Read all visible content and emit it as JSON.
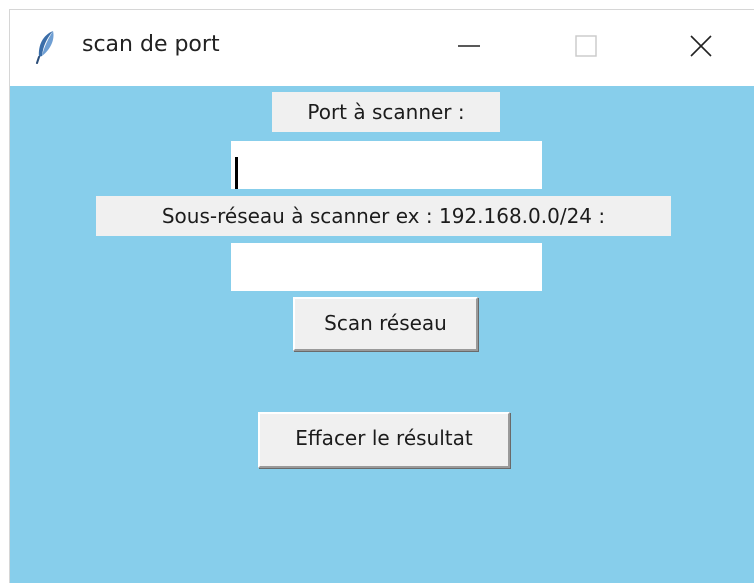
{
  "window": {
    "title": "scan de port",
    "icons": {
      "app": "feather-icon",
      "minimize": "minimize-icon",
      "maximize": "maximize-icon",
      "close": "close-icon"
    },
    "colors": {
      "client_background": "#87ceeb",
      "widget_background": "#f0f0f0",
      "titlebar_background": "#ffffff"
    }
  },
  "form": {
    "port_label": "Port à scanner :",
    "port_value": "",
    "subnet_label": "Sous-réseau à scanner ex : 192.168.0.0/24 :",
    "subnet_value": "",
    "scan_button": "Scan réseau",
    "clear_button": "Effacer le résultat"
  }
}
